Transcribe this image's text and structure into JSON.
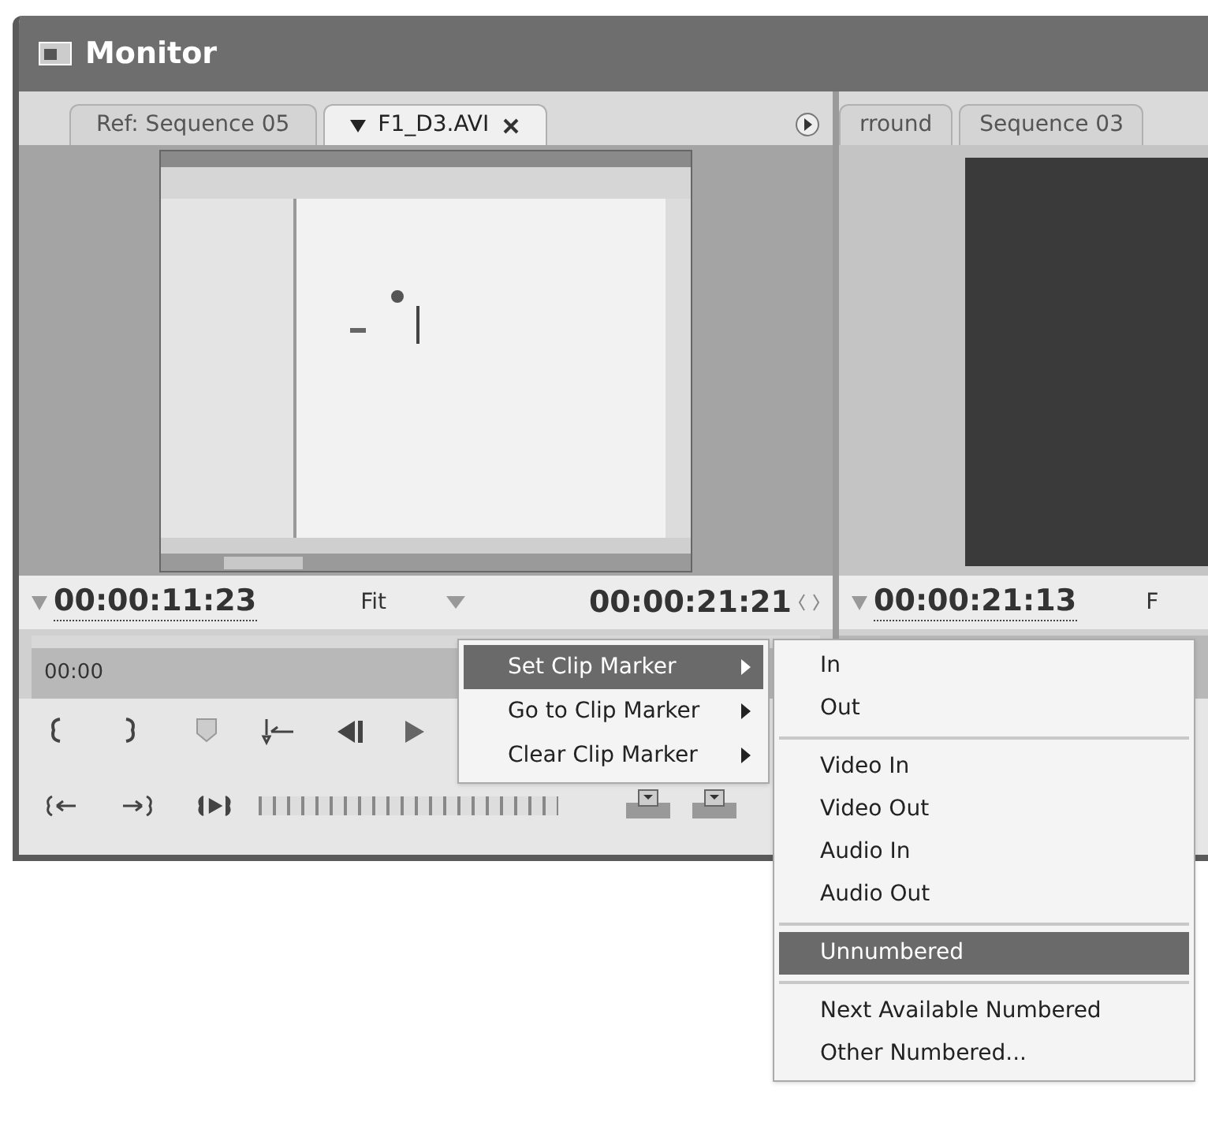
{
  "window": {
    "title": "Monitor"
  },
  "source_monitor": {
    "tabs": [
      {
        "label": "Ref: Sequence 05",
        "selected": false,
        "closable": false
      },
      {
        "label": "F1_D3.AVI",
        "selected": true,
        "closable": true
      }
    ],
    "timecode": "00:00:11:23",
    "zoom": "Fit",
    "duration": "00:00:21:21",
    "scrub_time": "00:00"
  },
  "program_monitor": {
    "tabs": [
      {
        "label": "rround",
        "selected": false
      },
      {
        "label": "Sequence 03",
        "selected": false
      }
    ],
    "timecode": "00:00:21:13",
    "zoom": "F"
  },
  "context_menu": {
    "items": [
      {
        "label": "Set Clip Marker",
        "selected": true
      },
      {
        "label": "Go to Clip Marker",
        "selected": false
      },
      {
        "label": "Clear Clip Marker",
        "selected": false
      }
    ]
  },
  "submenu": {
    "groups": [
      [
        {
          "label": "In",
          "selected": false
        },
        {
          "label": "Out",
          "selected": false
        }
      ],
      [
        {
          "label": "Video In",
          "selected": false
        },
        {
          "label": "Video Out",
          "selected": false
        },
        {
          "label": "Audio In",
          "selected": false
        },
        {
          "label": "Audio Out",
          "selected": false
        }
      ],
      [
        {
          "label": "Unnumbered",
          "selected": true
        }
      ],
      [
        {
          "label": "Next Available Numbered",
          "selected": false
        },
        {
          "label": "Other Numbered...",
          "selected": false
        }
      ]
    ]
  }
}
